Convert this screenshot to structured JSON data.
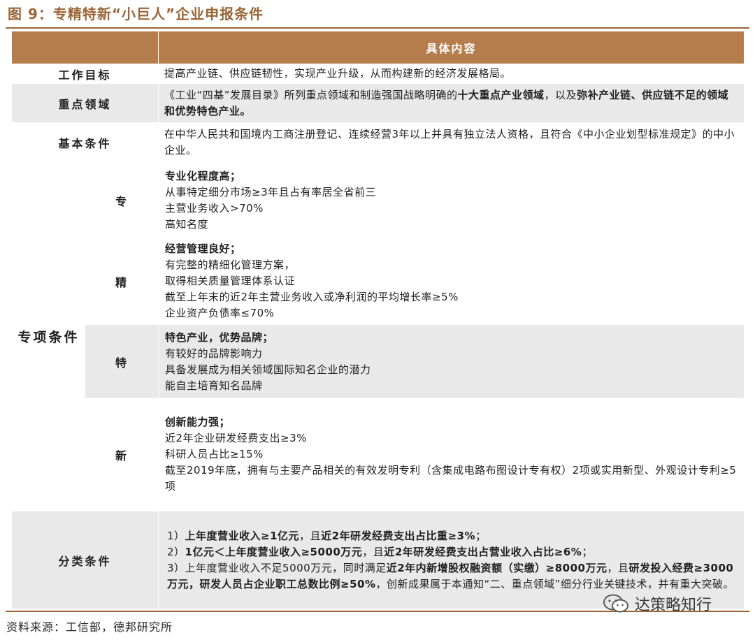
{
  "figure_title": "图 9：专精特新“小巨人”企业申报条件",
  "table": {
    "header": "具体内容",
    "work_goal": {
      "label": "工作目标",
      "content": "提高产业链、供应链韧性，实现产业升级，从而构建新的经济发展格局。"
    },
    "key_areas": {
      "label": "重点领域",
      "content_a": "《工业“四基”发展目录》所列重点领域和制造强国战略明确的",
      "content_b": "十大重点产业领域",
      "content_c": "，以及",
      "content_d": "弥补产业链、供应链不足的领域和优势特色产业。"
    },
    "basic_conditions": {
      "label": "基本条件",
      "content": "在中华人民共和国境内工商注册登记、连续经营3年以上并具有独立法人资格，且符合《中小企业划型标准规定》的中小企业。"
    },
    "special": {
      "label": "专项条件",
      "items": [
        {
          "label": "专",
          "heading": "专业化程度高；",
          "lines": [
            "从事特定细分市场≥3年且占有率居全省前三",
            "主营业务收入>70%",
            "高知名度"
          ]
        },
        {
          "label": "精",
          "heading": "经营管理良好；",
          "lines": [
            "有完整的精细化管理方案，",
            "取得相关质量管理体系认证",
            "截至上年末的近2年主营业务收入或净利润的平均增长率≥5%",
            "企业资产负债率≤70%"
          ]
        },
        {
          "label": "特",
          "heading": "特色产业，优势品牌；",
          "lines": [
            "有较好的品牌影响力",
            "具备发展成为相关领域国际知名企业的潜力",
            "能自主培育知名品牌"
          ]
        },
        {
          "label": "新",
          "heading": "创新能力强；",
          "lines": [
            "近2年企业研发经费支出≥3%",
            "科研人员占比≥15%",
            "截至2019年底，拥有与主要产品相关的有效发明专利（含集成电路布图设计专有权）2项或实用新型、外观设计专利≥5项"
          ]
        }
      ]
    },
    "classification": {
      "label": "分类条件",
      "line1_a": "1）",
      "line1_b": "上年度营业收入≥1亿元",
      "line1_c": "，且",
      "line1_d": "近2年研发经费支出占比重≥3%",
      "line1_e": "；",
      "line2_a": "2）",
      "line2_b": "1亿元＜上年度营业收入≥5000万元",
      "line2_c": "，且",
      "line2_d": "近2年研发经费支出占营业收入占比≥6%",
      "line2_e": "；",
      "line3_a": "3）上年度营业收入不足5000万元，同时满足",
      "line3_b": "近2年内新增股权融资额（实缴）≥8000万元",
      "line3_c": "，且",
      "line3_d": "研发投入经费≥3000万元，研发人员占企业职工总数比例≥50%",
      "line3_e": "，创新成果属于本通知“二、重点领域”细分行业关键技术，并有重大突破。"
    }
  },
  "source": "资料来源：工信部，德邦研究所",
  "watermark": "达策略知行",
  "colors": {
    "title": "#9a6536",
    "header_bg": "#b47d4b",
    "grey_row": "#e9e9e9"
  }
}
